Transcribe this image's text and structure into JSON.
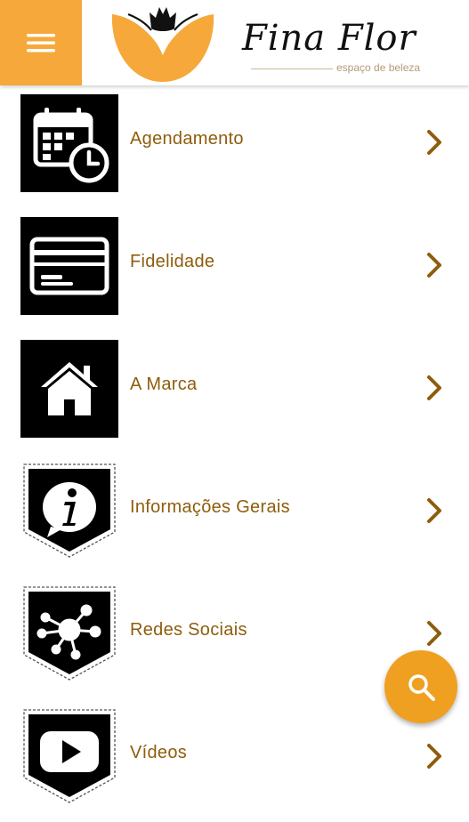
{
  "brand": {
    "name": "Fina Flor",
    "tagline": "espaço de beleza"
  },
  "colors": {
    "accent": "#F6A83A",
    "fab": "#F0A020",
    "label": "#8E5D0C",
    "icon_bg": "#000000"
  },
  "menu": {
    "items": [
      {
        "label": "Agendamento",
        "icon": "calendar-clock-icon"
      },
      {
        "label": "Fidelidade",
        "icon": "card-icon"
      },
      {
        "label": "A Marca",
        "icon": "home-icon"
      },
      {
        "label": "Informações Gerais",
        "icon": "info-icon"
      },
      {
        "label": "Redes Sociais",
        "icon": "network-icon"
      },
      {
        "label": "Vídeos",
        "icon": "play-icon"
      }
    ]
  },
  "fab": {
    "icon": "search-icon"
  },
  "header": {
    "menu_icon": "hamburger-icon"
  }
}
